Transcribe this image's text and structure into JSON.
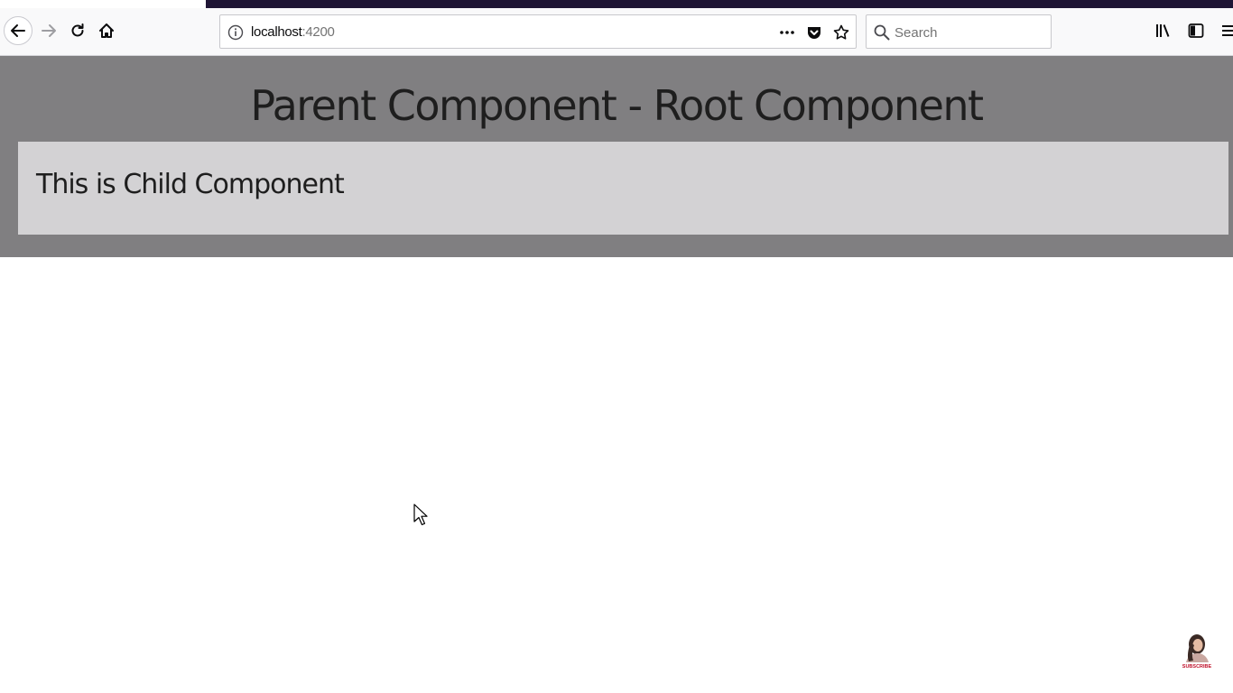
{
  "browser": {
    "url_host": "localhost",
    "url_port": ":4200",
    "search_placeholder": "Search"
  },
  "page": {
    "parent_title": "Parent Component - Root Component",
    "child_text": "This is Child Component"
  },
  "overlay": {
    "subscribe_label": "SUBSCRIBE"
  },
  "icons": {
    "back": "back-arrow-icon",
    "forward": "forward-arrow-icon",
    "reload": "reload-icon",
    "home": "home-icon",
    "info": "info-icon",
    "more": "more-dots-icon",
    "pocket": "pocket-icon",
    "bookmark": "star-icon",
    "search": "search-icon",
    "library": "library-icon",
    "sidebar": "sidebar-icon",
    "menu": "hamburger-menu-icon"
  },
  "colors": {
    "parent_bg": "#807f81",
    "child_bg": "#d3d2d4",
    "titlebar": "#1f1535"
  }
}
